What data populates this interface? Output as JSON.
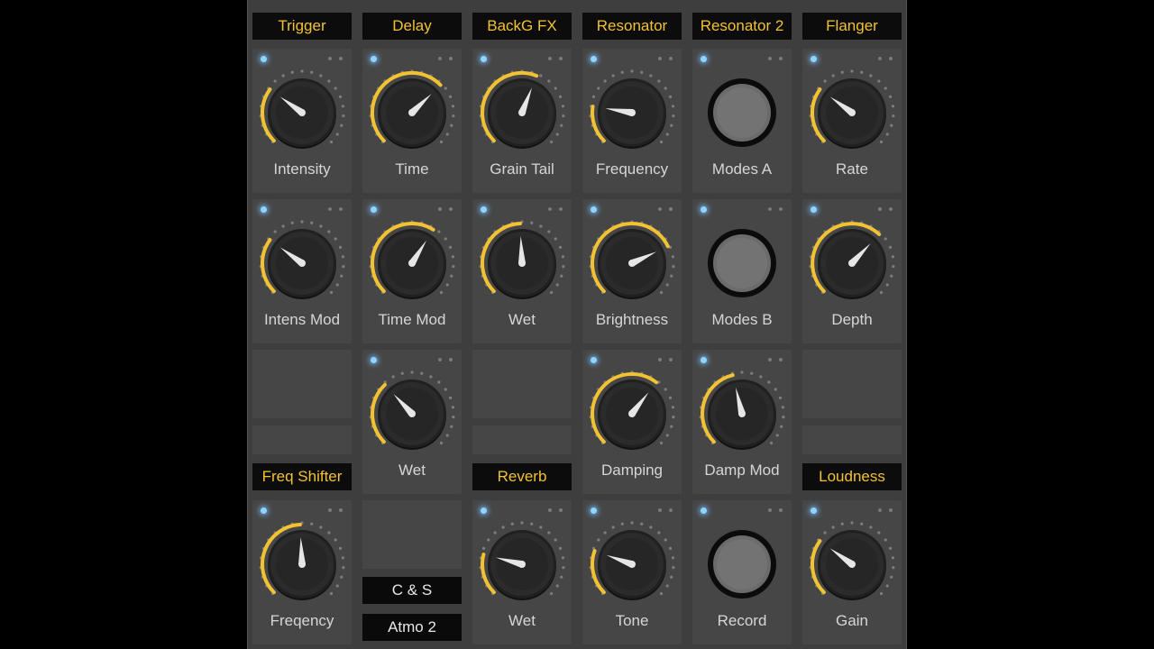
{
  "colors": {
    "accent": "#f2c233",
    "led": "#8fd4ff",
    "panel": "#3e3e3e",
    "tile": "#464646"
  },
  "headers": [
    "Trigger",
    "Delay",
    "BackG FX",
    "Resonator",
    "Resonator 2",
    "Flanger",
    "Freq Shifter",
    "Reverb",
    "Loudness"
  ],
  "buttons": [
    "C & S",
    "Atmo 2"
  ],
  "knobs": [
    {
      "label": "Intensity",
      "value": 0.3,
      "type": "knob"
    },
    {
      "label": "Time",
      "value": 0.67,
      "type": "knob"
    },
    {
      "label": "Grain Tail",
      "value": 0.58,
      "type": "knob"
    },
    {
      "label": "Frequency",
      "value": 0.2,
      "type": "knob"
    },
    {
      "label": "Modes A",
      "value": 0,
      "type": "button"
    },
    {
      "label": "Rate",
      "value": 0.3,
      "type": "knob"
    },
    {
      "label": "Intens Mod",
      "value": 0.3,
      "type": "knob"
    },
    {
      "label": "Time Mod",
      "value": 0.62,
      "type": "knob"
    },
    {
      "label": "Wet",
      "value": 0.49,
      "type": "knob"
    },
    {
      "label": "Brightness",
      "value": 0.74,
      "type": "knob"
    },
    {
      "label": "Modes B",
      "value": 0,
      "type": "button"
    },
    {
      "label": "Depth",
      "value": 0.66,
      "type": "knob"
    },
    {
      "label": "Wet",
      "value": 0.34,
      "type": "knob"
    },
    {
      "label": "Damping",
      "value": 0.64,
      "type": "knob"
    },
    {
      "label": "Damp Mod",
      "value": 0.45,
      "type": "knob"
    },
    {
      "label": "Freqency",
      "value": 0.49,
      "type": "knob"
    },
    {
      "label": "Wet",
      "value": 0.22,
      "type": "knob"
    },
    {
      "label": "Tone",
      "value": 0.24,
      "type": "knob"
    },
    {
      "label": "Record",
      "value": 0,
      "type": "button"
    },
    {
      "label": "Gain",
      "value": 0.3,
      "type": "knob"
    }
  ]
}
